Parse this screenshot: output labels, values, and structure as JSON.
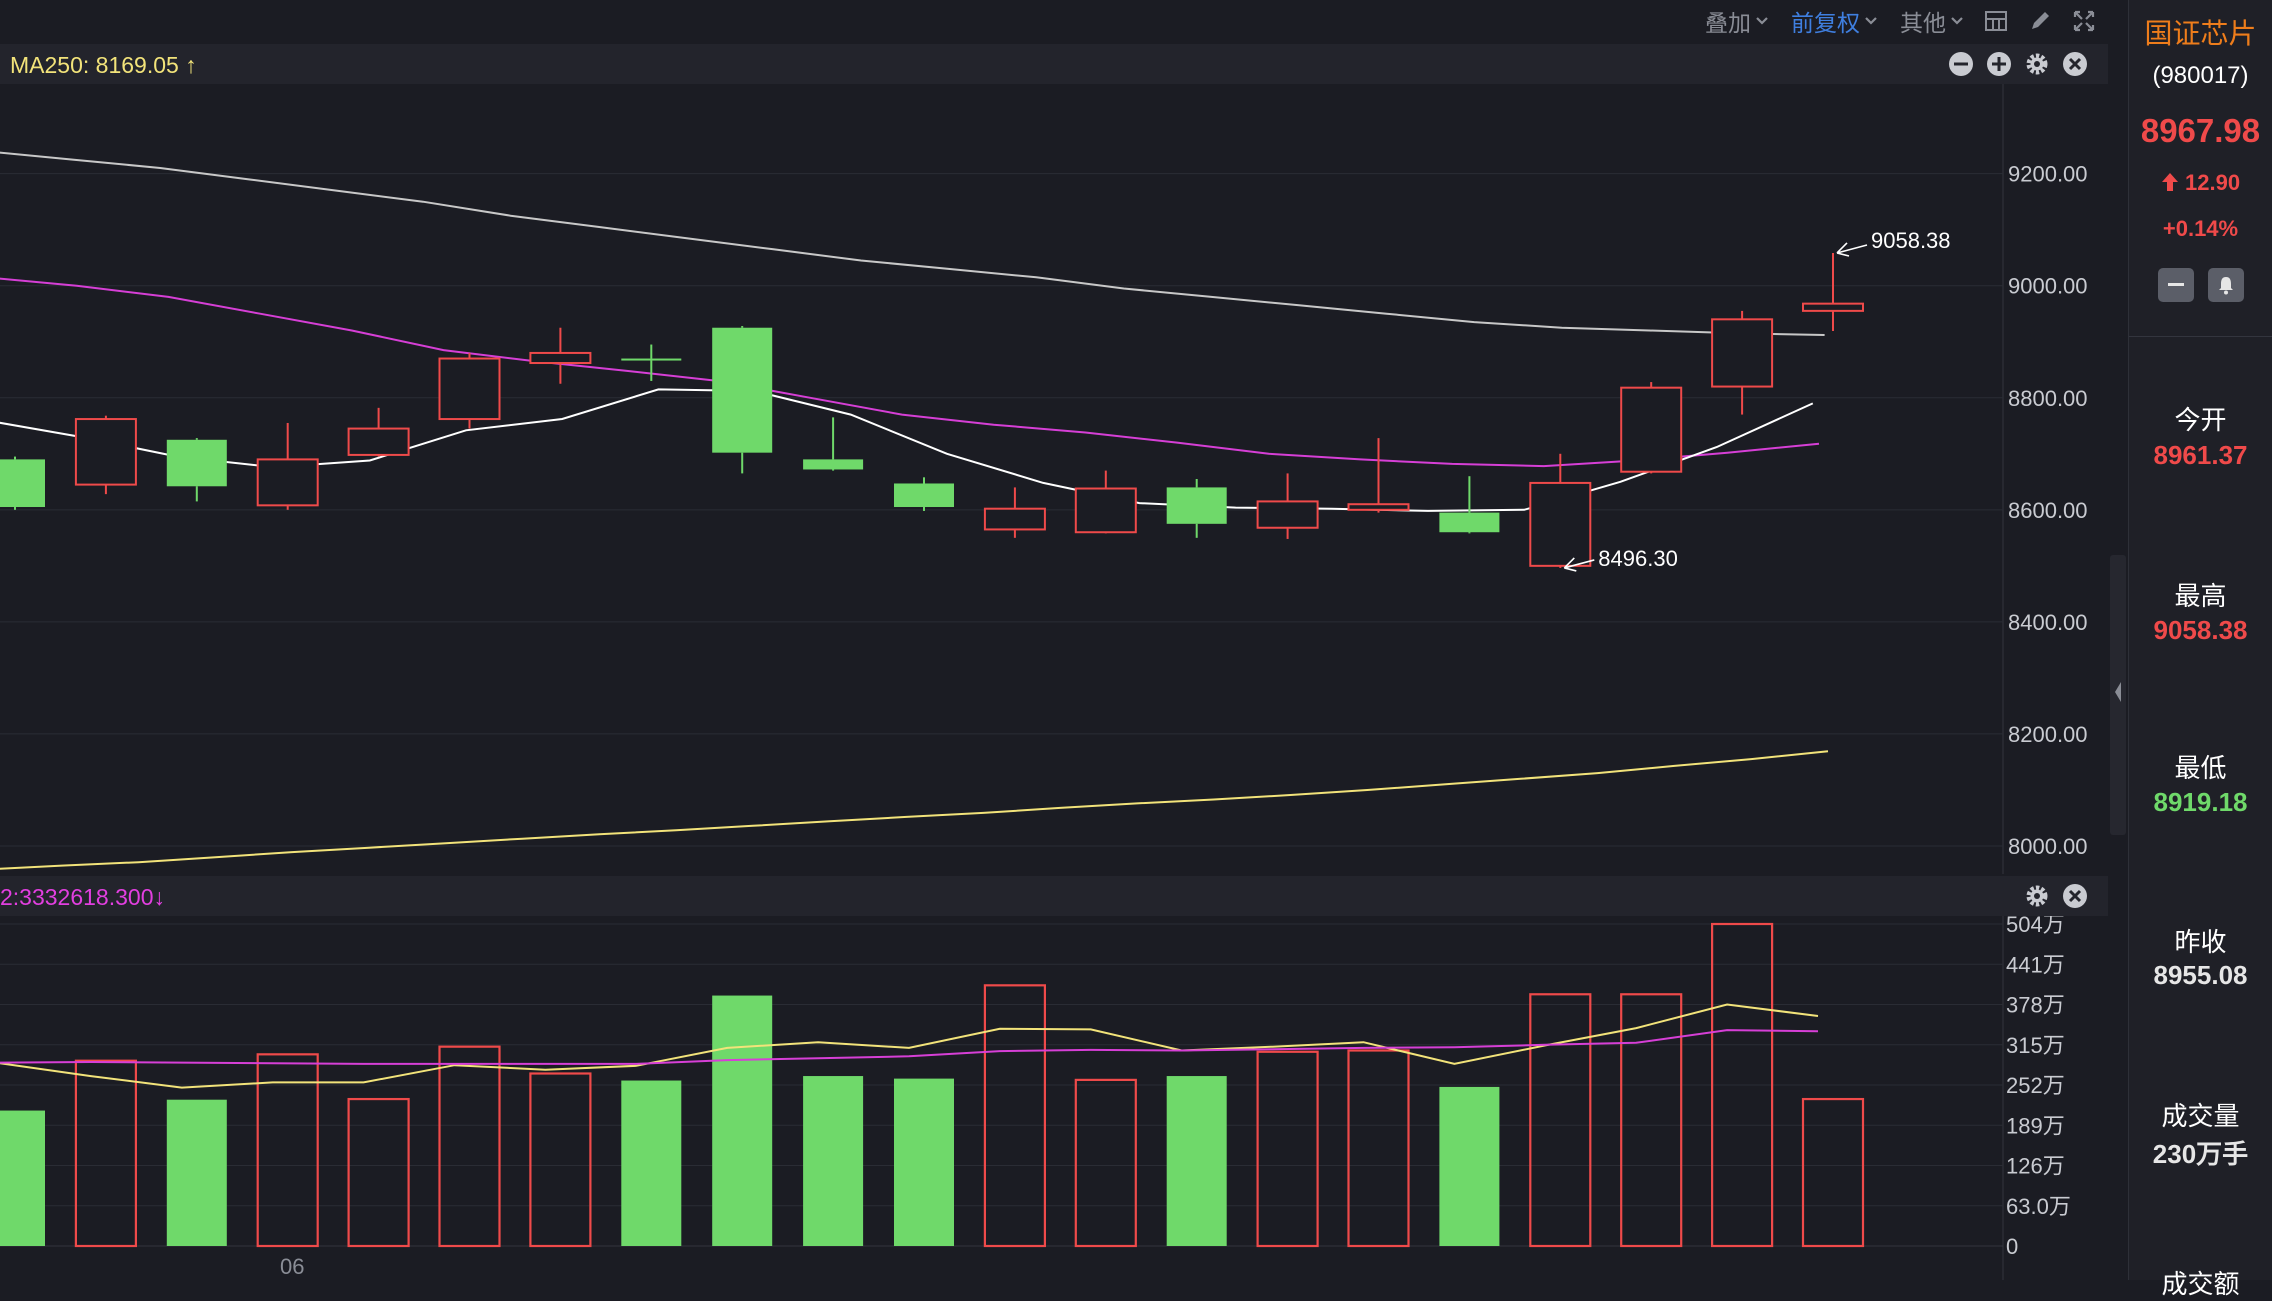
{
  "toolbar": {
    "overlay_label": "叠加",
    "adjust_label": "前复权",
    "other_label": "其他"
  },
  "price_panel": {
    "ma_label": "MA250: 8169.05 ↑",
    "axis_ticks": [
      "9200.00",
      "9000.00",
      "8800.00",
      "8600.00",
      "8400.00",
      "8200.00",
      "8000.00"
    ],
    "high_annotation": "9058.38",
    "low_annotation": "8496.30"
  },
  "volume_panel": {
    "label": "2:3332618.300↓",
    "axis_ticks": [
      "504万",
      "441万",
      "378万",
      "315万",
      "252万",
      "189万",
      "126万",
      "63.0万",
      "0"
    ],
    "date_label": "06"
  },
  "quote": {
    "name": "国证芯片",
    "code": "(980017)",
    "price": "8967.98",
    "change": "12.90",
    "change_pct": "+0.14%",
    "stats": [
      {
        "label": "今开",
        "value": "8961.37",
        "color": "#ef4a4a"
      },
      {
        "label": "最高",
        "value": "9058.38",
        "color": "#ef4a4a"
      },
      {
        "label": "最低",
        "value": "8919.18",
        "color": "#6fd96a"
      },
      {
        "label": "昨收",
        "value": "8955.08",
        "color": "#e6e6e6"
      },
      {
        "label": "成交量",
        "value": "230万手",
        "color": "#e6e6e6"
      },
      {
        "label": "成交额",
        "value": "",
        "color": "#e6e6e6"
      }
    ]
  },
  "colors": {
    "up": "#ef4a4a",
    "down": "#6fd96a",
    "ma5": "#ffffff",
    "ma20": "#d63fd6",
    "ma60": "#c8c8c8",
    "ma250": "#f2e37a",
    "vol_ma1": "#f2e37a",
    "vol_ma2": "#d63fd6"
  },
  "chart_data": [
    {
      "type": "candlestick",
      "title": "",
      "ylim": [
        7950,
        9360
      ],
      "tick_values": [
        9200,
        9000,
        8800,
        8600,
        8400,
        8200,
        8000
      ],
      "candles": [
        {
          "open": 8690,
          "close": 8605,
          "high": 8695,
          "low": 8600
        },
        {
          "open": 8645,
          "close": 8762,
          "high": 8768,
          "low": 8628
        },
        {
          "open": 8725,
          "close": 8642,
          "high": 8728,
          "low": 8615
        },
        {
          "open": 8608,
          "close": 8690,
          "high": 8755,
          "low": 8600
        },
        {
          "open": 8698,
          "close": 8745,
          "high": 8782,
          "low": 8695
        },
        {
          "open": 8762,
          "close": 8870,
          "high": 8880,
          "low": 8745
        },
        {
          "open": 8862,
          "close": 8880,
          "high": 8925,
          "low": 8825
        },
        {
          "open": 8870,
          "close": 8868,
          "high": 8895,
          "low": 8830
        },
        {
          "open": 8925,
          "close": 8702,
          "high": 8928,
          "low": 8665
        },
        {
          "open": 8690,
          "close": 8672,
          "high": 8765,
          "low": 8670
        },
        {
          "open": 8647,
          "close": 8605,
          "high": 8658,
          "low": 8598
        },
        {
          "open": 8565,
          "close": 8602,
          "high": 8640,
          "low": 8550
        },
        {
          "open": 8560,
          "close": 8638,
          "high": 8670,
          "low": 8558
        },
        {
          "open": 8640,
          "close": 8575,
          "high": 8655,
          "low": 8550
        },
        {
          "open": 8568,
          "close": 8615,
          "high": 8665,
          "low": 8548
        },
        {
          "open": 8600,
          "close": 8610,
          "high": 8728,
          "low": 8595
        },
        {
          "open": 8595,
          "close": 8560,
          "high": 8660,
          "low": 8558
        },
        {
          "open": 8500,
          "close": 8648,
          "high": 8700,
          "low": 8496.3
        },
        {
          "open": 8668,
          "close": 8818,
          "high": 8828,
          "low": 8665
        },
        {
          "open": 8820,
          "close": 8940,
          "high": 8955,
          "low": 8770
        },
        {
          "open": 8955.08,
          "close": 8967.98,
          "high": 9058.38,
          "low": 8919.18
        }
      ],
      "ma_series": [
        {
          "name": "MA250",
          "values": [
            7958,
            7965,
            7971,
            7980,
            7989,
            7997,
            8005,
            8013,
            8021,
            8028,
            8036,
            8044,
            8052,
            8059,
            8068,
            8076,
            8083,
            8091,
            8100,
            8110,
            8120,
            8130,
            8143,
            8155,
            8169.05
          ]
        }
      ]
    },
    {
      "type": "bar",
      "title": "",
      "ylim": [
        0,
        5040000
      ],
      "values": [
        2120000,
        2900000,
        2290000,
        3000000,
        2300000,
        3120000,
        2700000,
        2590000,
        3920000,
        2660000,
        2620000,
        4080000,
        2600000,
        2660000,
        3040000,
        3060000,
        2490000,
        3940000,
        3940000,
        5040000,
        2300000
      ]
    }
  ]
}
